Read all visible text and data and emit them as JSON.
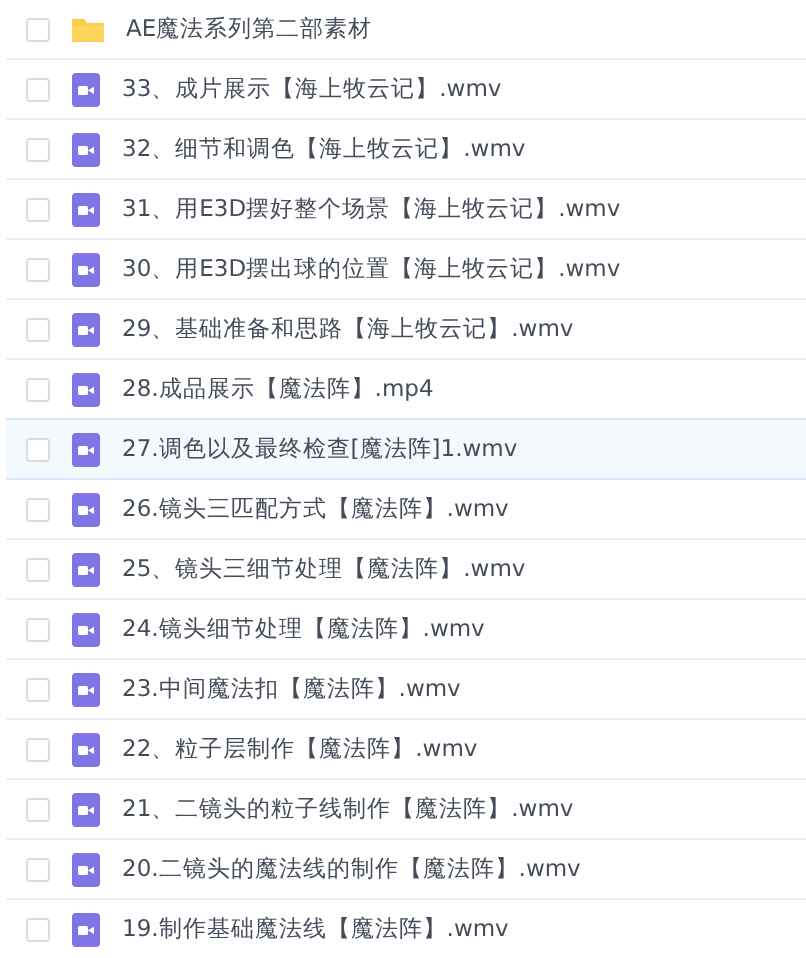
{
  "files": [
    {
      "kind": "folder",
      "name": "AE魔法系列第二部素材",
      "checked": false,
      "highlighted": false
    },
    {
      "kind": "video",
      "name": "33、成片展示【海上牧云记】.wmv",
      "checked": false,
      "highlighted": false
    },
    {
      "kind": "video",
      "name": "32、细节和调色【海上牧云记】.wmv",
      "checked": false,
      "highlighted": false
    },
    {
      "kind": "video",
      "name": "31、用E3D摆好整个场景【海上牧云记】.wmv",
      "checked": false,
      "highlighted": false
    },
    {
      "kind": "video",
      "name": "30、用E3D摆出球的位置【海上牧云记】.wmv",
      "checked": false,
      "highlighted": false
    },
    {
      "kind": "video",
      "name": "29、基础准备和思路【海上牧云记】.wmv",
      "checked": false,
      "highlighted": false
    },
    {
      "kind": "video",
      "name": "28.成品展示【魔法阵】.mp4",
      "checked": false,
      "highlighted": false
    },
    {
      "kind": "video",
      "name": "27.调色以及最终检查[魔法阵]1.wmv",
      "checked": false,
      "highlighted": true
    },
    {
      "kind": "video",
      "name": "26.镜头三匹配方式【魔法阵】.wmv",
      "checked": false,
      "highlighted": false
    },
    {
      "kind": "video",
      "name": "25、镜头三细节处理【魔法阵】.wmv",
      "checked": false,
      "highlighted": false
    },
    {
      "kind": "video",
      "name": "24.镜头细节处理【魔法阵】.wmv",
      "checked": false,
      "highlighted": false
    },
    {
      "kind": "video",
      "name": "23.中间魔法扣【魔法阵】.wmv",
      "checked": false,
      "highlighted": false
    },
    {
      "kind": "video",
      "name": "22、粒子层制作【魔法阵】.wmv",
      "checked": false,
      "highlighted": false
    },
    {
      "kind": "video",
      "name": "21、二镜头的粒子线制作【魔法阵】.wmv",
      "checked": false,
      "highlighted": false
    },
    {
      "kind": "video",
      "name": "20.二镜头的魔法线的制作【魔法阵】.wmv",
      "checked": false,
      "highlighted": false
    },
    {
      "kind": "video",
      "name": "19.制作基础魔法线【魔法阵】.wmv",
      "checked": false,
      "highlighted": false
    }
  ]
}
